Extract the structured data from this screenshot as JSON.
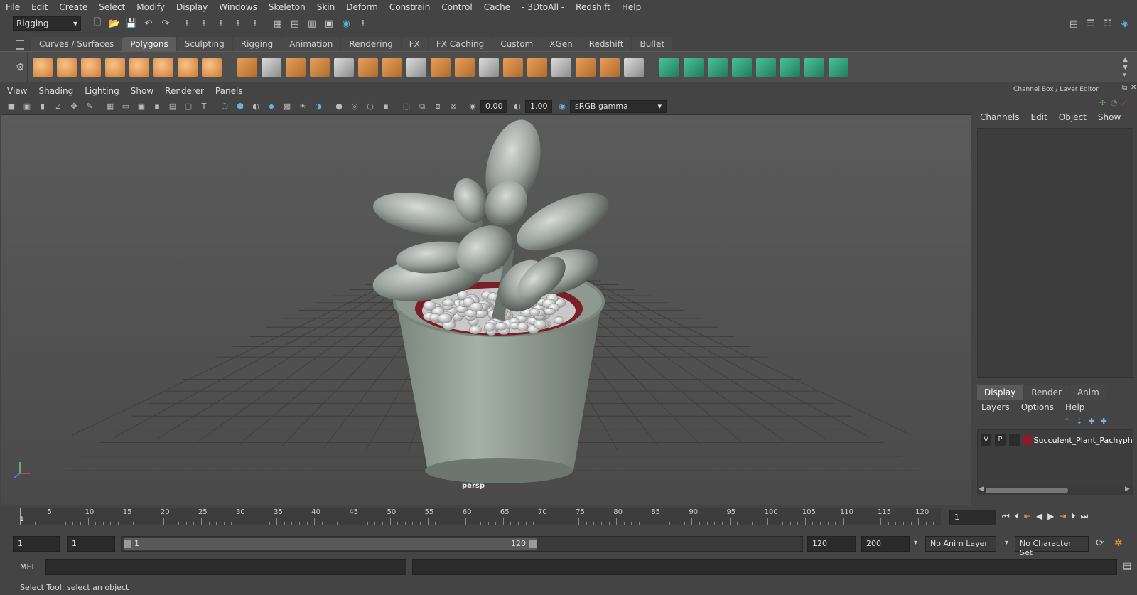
{
  "menubar": [
    "File",
    "Edit",
    "Create",
    "Select",
    "Modify",
    "Display",
    "Windows",
    "Skeleton",
    "Skin",
    "Deform",
    "Constrain",
    "Control",
    "Cache",
    "- 3DtoAll -",
    "Redshift",
    "Help"
  ],
  "status_line": {
    "mode": "Rigging"
  },
  "shelf_tabs": [
    {
      "label": "Curves / Surfaces",
      "active": false
    },
    {
      "label": "Polygons",
      "active": true
    },
    {
      "label": "Sculpting",
      "active": false
    },
    {
      "label": "Rigging",
      "active": false
    },
    {
      "label": "Animation",
      "active": false
    },
    {
      "label": "Rendering",
      "active": false
    },
    {
      "label": "FX",
      "active": false
    },
    {
      "label": "FX Caching",
      "active": false
    },
    {
      "label": "Custom",
      "active": false
    },
    {
      "label": "XGen",
      "active": false
    },
    {
      "label": "Redshift",
      "active": false
    },
    {
      "label": "Bullet",
      "active": false
    }
  ],
  "viewport": {
    "menus": [
      "View",
      "Shading",
      "Lighting",
      "Show",
      "Renderer",
      "Panels"
    ],
    "exposure": "0.00",
    "gamma": "1.00",
    "color_space": "sRGB gamma",
    "camera_label": "persp"
  },
  "right_panel": {
    "title": "Channel Box / Layer Editor",
    "channel_menus": [
      "Channels",
      "Edit",
      "Object",
      "Show"
    ],
    "layer_tabs": [
      {
        "label": "Display",
        "active": true
      },
      {
        "label": "Render",
        "active": false
      },
      {
        "label": "Anim",
        "active": false
      }
    ],
    "layer_menus": [
      "Layers",
      "Options",
      "Help"
    ],
    "layer": {
      "v": "V",
      "p": "P",
      "name": "Succulent_Plant_Pachyphytum",
      "color": "#8b1a2a"
    }
  },
  "timeline": {
    "ticks": [
      "5",
      "10",
      "15",
      "20",
      "25",
      "30",
      "35",
      "40",
      "45",
      "50",
      "55",
      "60",
      "65",
      "70",
      "75",
      "80",
      "85",
      "90",
      "95",
      "100",
      "105",
      "110",
      "115",
      "120"
    ],
    "start_marker": "1",
    "current_frame": "1"
  },
  "range": {
    "start": "1",
    "playback_start": "1",
    "slider_start": "1",
    "slider_end": "120",
    "playback_end": "120",
    "end": "200",
    "anim_layer": "No Anim Layer",
    "character_set": "No Character Set"
  },
  "command_line": {
    "label": "MEL"
  },
  "help_line": "Select Tool: select an object",
  "colors": {
    "accent": "#5d5d5d",
    "shelf_orange": "#e8a05a",
    "shelf_green": "#3aa07a"
  }
}
